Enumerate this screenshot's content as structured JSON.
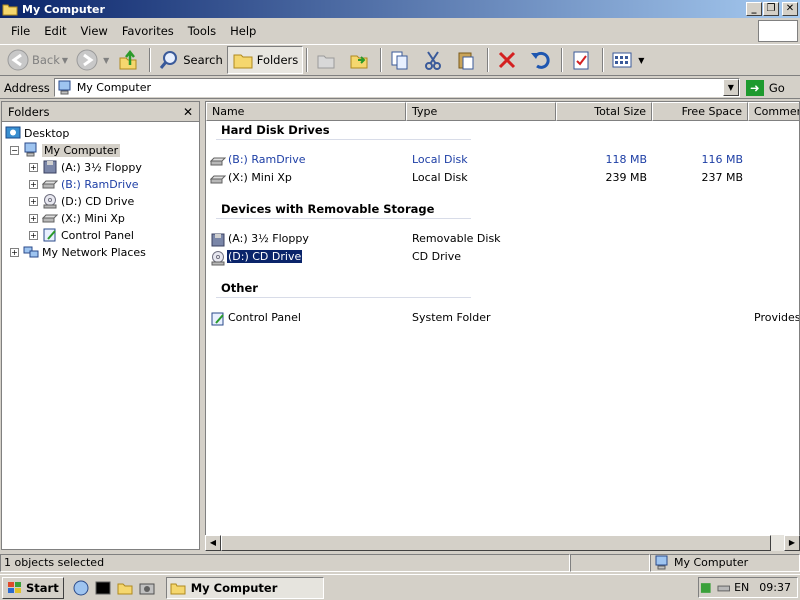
{
  "window": {
    "title": "My Computer",
    "min": "_",
    "max": "❐",
    "close": "✕"
  },
  "menu": [
    "File",
    "Edit",
    "View",
    "Favorites",
    "Tools",
    "Help"
  ],
  "toolbar": {
    "back": "Back",
    "search": "Search",
    "folders": "Folders"
  },
  "address": {
    "label": "Address",
    "value": "My Computer",
    "go": "Go"
  },
  "folders_pane": {
    "title": "Folders",
    "tree": [
      {
        "label": "Desktop"
      },
      {
        "label": "My Computer"
      },
      {
        "label": "(A:) 3½ Floppy"
      },
      {
        "label": "(B:) RamDrive"
      },
      {
        "label": "(D:) CD Drive"
      },
      {
        "label": "(X:) Mini Xp"
      },
      {
        "label": "Control Panel"
      },
      {
        "label": "My Network Places"
      }
    ]
  },
  "columns": [
    "Name",
    "Type",
    "Total Size",
    "Free Space",
    "Comments"
  ],
  "groups": [
    {
      "title": "Hard Disk Drives"
    },
    {
      "title": "Devices with Removable Storage"
    },
    {
      "title": "Other"
    }
  ],
  "rows": [
    {
      "name": "(B:) RamDrive",
      "type": "Local Disk",
      "total": "118 MB",
      "free": "116 MB",
      "comment": ""
    },
    {
      "name": "(X:) Mini Xp",
      "type": "Local Disk",
      "total": "239 MB",
      "free": "237 MB",
      "comment": ""
    },
    {
      "name": "(A:) 3½ Floppy",
      "type": "Removable Disk",
      "total": "",
      "free": "",
      "comment": ""
    },
    {
      "name": "(D:) CD Drive",
      "type": "CD Drive",
      "total": "",
      "free": "",
      "comment": ""
    },
    {
      "name": "Control Panel",
      "type": "System Folder",
      "total": "",
      "free": "",
      "comment": "Provides"
    }
  ],
  "status": {
    "left": "1 objects selected",
    "right": "My Computer"
  },
  "taskbar": {
    "start": "Start",
    "task": "My Computer",
    "lang": "EN",
    "time": "09:37"
  },
  "icons": {
    "folder": "folder-icon",
    "computer": "computer-icon",
    "drive": "drive-icon",
    "floppy": "floppy-icon",
    "cd": "cd-icon",
    "control": "control-panel-icon"
  },
  "colors": {
    "title_start": "#0a246a",
    "title_end": "#a6caf0",
    "selection": "#0a246a",
    "link_blue": "#1d3ea5"
  }
}
